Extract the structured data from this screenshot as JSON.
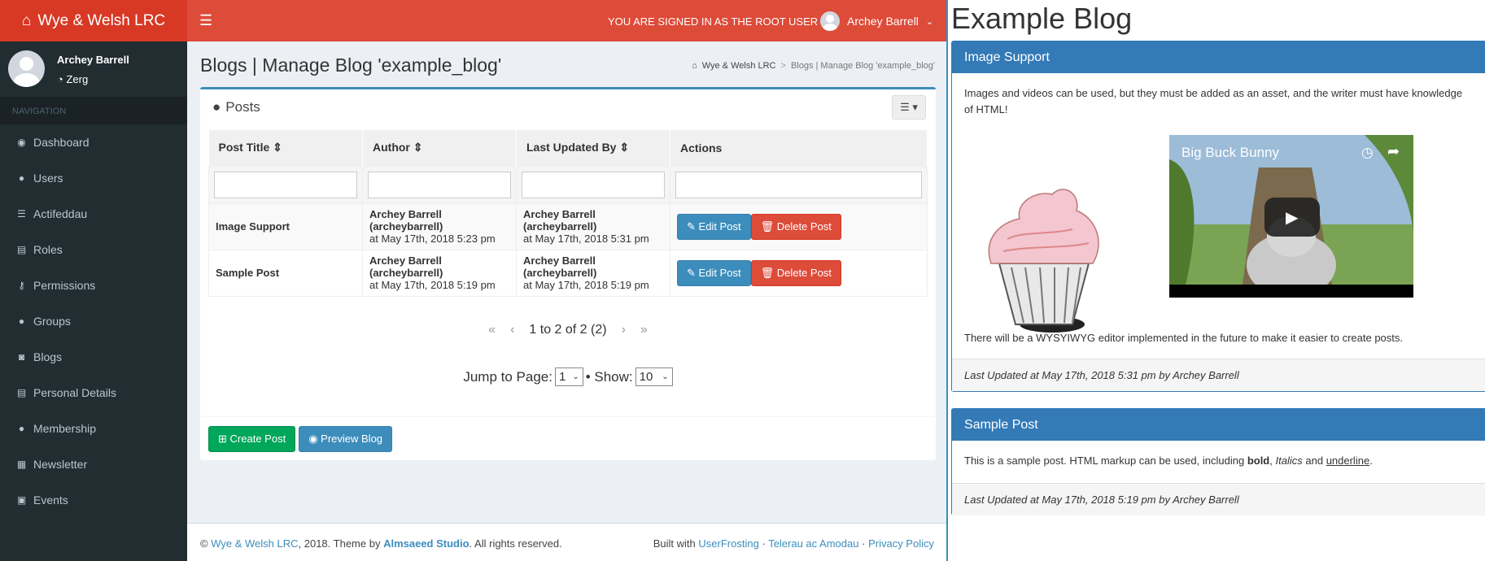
{
  "header": {
    "brand": "Wye & Welsh LRC",
    "signed_in": "YOU ARE SIGNED IN AS THE ROOT USER",
    "user": "Archey Barrell"
  },
  "sidebar": {
    "user_name": "Archey Barrell",
    "user_group": "Zerg",
    "nav_header": "NAVIGATION",
    "items": [
      {
        "label": "Dashboard",
        "icon": "dashboard-icon"
      },
      {
        "label": "Users",
        "icon": "user-icon"
      },
      {
        "label": "Actifeddau",
        "icon": "activity-icon"
      },
      {
        "label": "Roles",
        "icon": "roles-icon"
      },
      {
        "label": "Permissions",
        "icon": "key-icon"
      },
      {
        "label": "Groups",
        "icon": "groups-icon"
      },
      {
        "label": "Blogs",
        "icon": "rss-icon"
      },
      {
        "label": "Personal Details",
        "icon": "list-icon"
      },
      {
        "label": "Membership",
        "icon": "membership-icon"
      },
      {
        "label": "Newsletter",
        "icon": "newspaper-icon"
      },
      {
        "label": "Events",
        "icon": "calendar-icon"
      }
    ]
  },
  "page": {
    "title": "Blogs | Manage Blog 'example_blog'",
    "breadcrumb": [
      "Wye & Welsh LRC",
      "Blogs | Manage Blog 'example_blog'"
    ]
  },
  "posts_box": {
    "title": "Posts",
    "columns": [
      "Post Title",
      "Author",
      "Last Updated By",
      "Actions"
    ],
    "rows": [
      {
        "title": "Image Support",
        "author": "Archey Barrell (archeybarrell)",
        "author_date": "at May 17th, 2018 5:23 pm",
        "updated_by": "Archey Barrell (archeybarrell)",
        "updated_date": "at May 17th, 2018 5:31 pm"
      },
      {
        "title": "Sample Post",
        "author": "Archey Barrell (archeybarrell)",
        "author_date": "at May 17th, 2018 5:19 pm",
        "updated_by": "Archey Barrell (archeybarrell)",
        "updated_date": "at May 17th, 2018 5:19 pm"
      }
    ],
    "edit_label": "Edit Post",
    "delete_label": "Delete Post",
    "pager_text": "1 to 2 of 2 (2)",
    "jump_label": "Jump to Page:",
    "jump_value": "1",
    "show_label": "• Show:",
    "show_value": "10",
    "create_label": "Create Post",
    "preview_label": "Preview Blog"
  },
  "footer": {
    "copyright_pre": "©",
    "brand_link": "Wye & Welsh LRC",
    "year_theme": ", 2018. Theme by",
    "studio": "Almsaeed Studio",
    "rights": ". All rights reserved.",
    "built_with": "Built with",
    "userfrosting": "UserFrosting",
    "telerau": "Telerau ac Amodau",
    "privacy": "Privacy Policy",
    "dot": "·"
  },
  "blog": {
    "title": "Example Blog",
    "posts": [
      {
        "title": "Image Support",
        "body": "Images and videos can be used, but they must be added as an asset, and the writer must have knowledge of HTML!",
        "body2": "There will be a WYSYIWYG editor implemented in the future to make it easier to create posts.",
        "video_title": "Big Buck Bunny",
        "footer": "Last Updated at May 17th, 2018 5:31 pm by Archey Barrell"
      },
      {
        "title": "Sample Post",
        "body_pre": "This is a sample post. HTML markup can be used, including",
        "bold": "bold",
        "sep1": ",",
        "italic": "Italics",
        "and": "and",
        "underline": "underline",
        "end": ".",
        "footer": "Last Updated at May 17th, 2018 5:19 pm by Archey Barrell"
      }
    ]
  },
  "colors": {
    "header": "#dd4b39",
    "logo": "#d73925",
    "sidebar": "#222d32",
    "primary": "#3c8dbc",
    "panel": "#337ab7"
  }
}
